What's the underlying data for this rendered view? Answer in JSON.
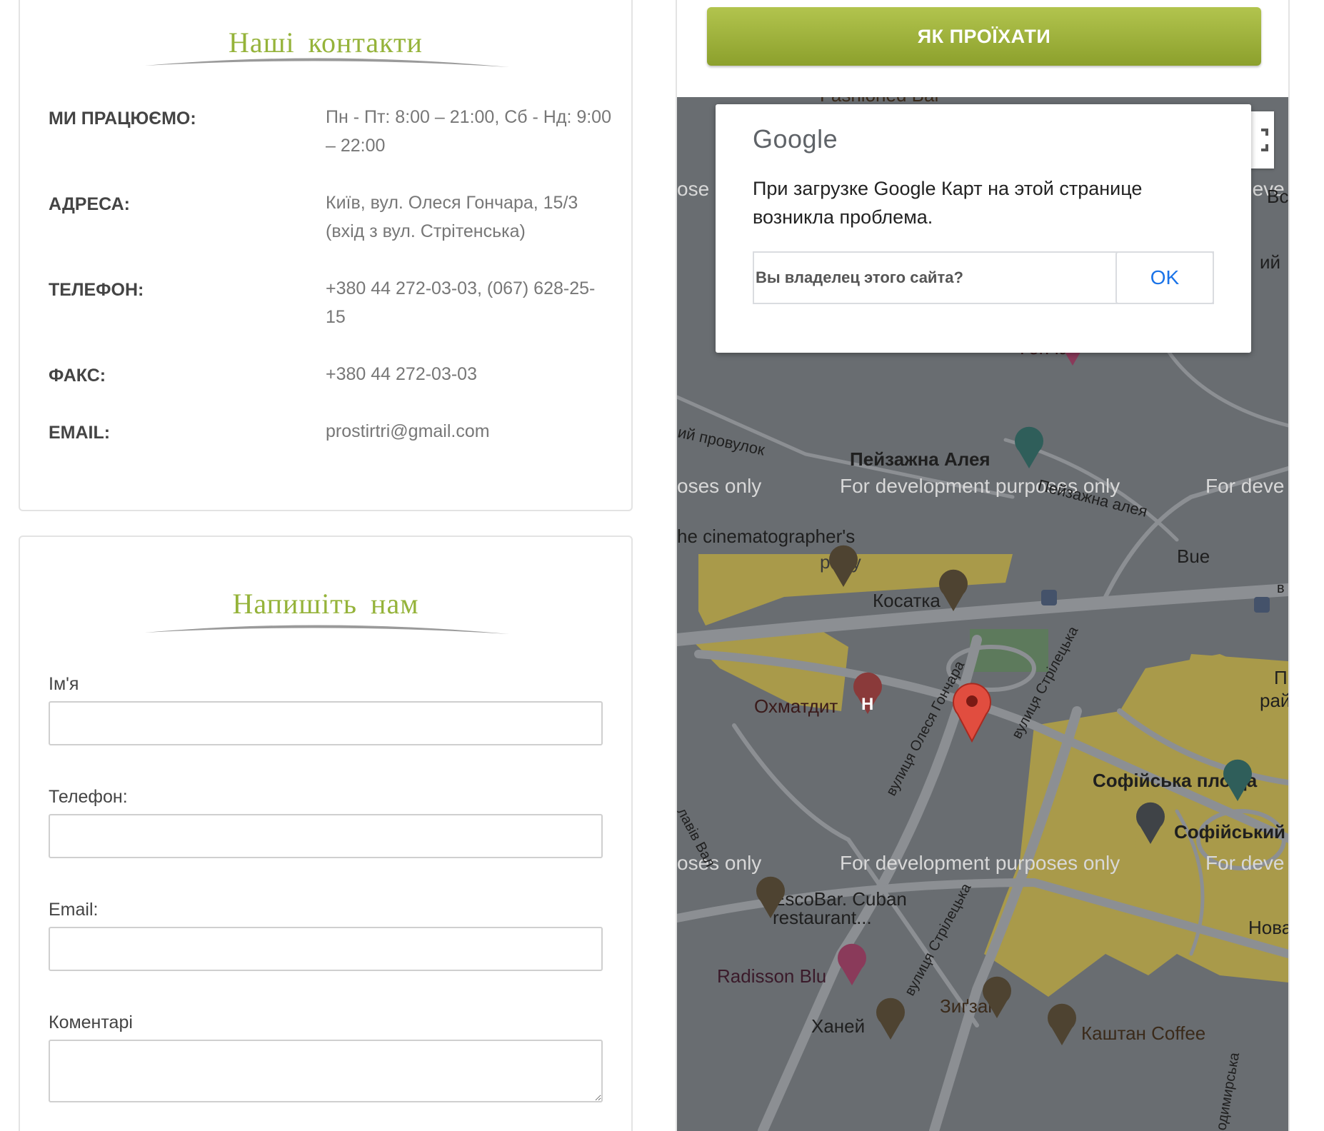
{
  "contacts": {
    "title": "Наші контакти",
    "rows": [
      {
        "label": "МИ ПРАЦЮЄМО:",
        "value": "Пн - Пт: 8:00 – 21:00, Сб - Нд: 9:00 – 22:00"
      },
      {
        "label": "АДРЕСА:",
        "value": "Київ, вул. Олеся Гончара, 15/3 (вхід з вул. Стрітенська)"
      },
      {
        "label": "ТЕЛЕФОН:",
        "value": "+380 44 272-03-03, (067) 628-25-15"
      },
      {
        "label": "ФАКС:",
        "value": "+380 44 272-03-03"
      },
      {
        "label": "EMAIL:",
        "value": "prostirtri@gmail.com"
      }
    ]
  },
  "form": {
    "title": "Напишіть нам",
    "fields": [
      {
        "label": "Ім'я",
        "value": ""
      },
      {
        "label": "Телефон:",
        "value": ""
      },
      {
        "label": "Email:",
        "value": ""
      },
      {
        "label": "Коментарі",
        "value": ""
      }
    ]
  },
  "directions": {
    "button_label": "ЯК ПРОЇХАТИ"
  },
  "map_dialog": {
    "logo": "Google",
    "message": "При загрузке Google Карт на этой странице возникла проблема.",
    "owner_question": "Вы владелец этого сайта?",
    "ok_label": "OK"
  },
  "map": {
    "watermark": "For development purposes only",
    "watermark_left": "oses only",
    "watermark_right": "For deve",
    "watermark_top_left": "ose",
    "watermark_top_right": "deve",
    "places": {
      "peizazhna_aleia": "Пейзажна Алея",
      "peizazhna_aleia_street": "Пейзажна алея",
      "provulok": "ий провулок",
      "cinematographers": "he cinematographer's",
      "party": "party",
      "kosatka": "Косатка",
      "okhmatdyt": "Охматдит",
      "vul_olesia_honchara": "вулиця Олеся Гончара",
      "vul_striletska": "вулиця Стрілецька",
      "vul_striletska_2": "вулиця Стрілецька",
      "sofiiska_ploshcha": "Софійська площа",
      "sofiiskyi": "Софійський",
      "yaroslaviv_val": "лавів Вал",
      "escobar": "EscoBar. Cuban",
      "escobar_2": "restaurant...",
      "radisson": "Radisson Blu",
      "zigzag": "Зиґзаґ",
      "khanei": "Ханей",
      "kashtan_coffee": "Каштан Coffee",
      "volodymyrska": "одимирська",
      "buena_vista": "Bue",
      "honchar": "Гончар",
      "fashioned_bar": "Fashioned Bar",
      "nova": "Нова",
      "p_letter": "П",
      "rai": "рай",
      "vs": "Вс",
      "yi": "ий",
      "v_letter": "в",
      "h_icon": "H"
    },
    "colors": {
      "background": "#696d71",
      "road": "#8c8f93",
      "yellow": "#a99a4a",
      "park": "#5d7a5c",
      "marker_red": "#e14d3f",
      "pin_dark": "#4e4331"
    }
  }
}
